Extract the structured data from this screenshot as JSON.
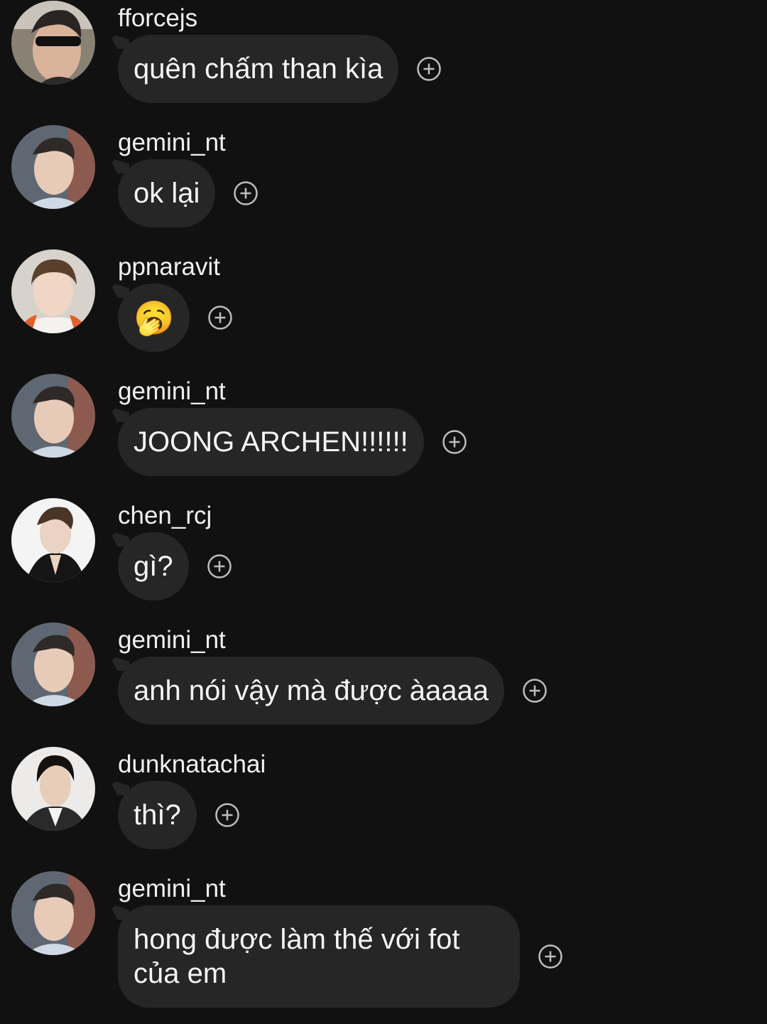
{
  "messages": [
    {
      "username": "fforcejs",
      "text": "quên chấm than kìa",
      "avatar": "avatar-fforcejs",
      "react_icon": "add-reaction-icon"
    },
    {
      "username": "gemini_nt",
      "text": "ok lại",
      "avatar": "avatar-gemini_nt",
      "react_icon": "add-reaction-icon"
    },
    {
      "username": "ppnaravit",
      "text": "🥱",
      "avatar": "avatar-ppnaravit",
      "react_icon": "add-reaction-icon"
    },
    {
      "username": "gemini_nt",
      "text": "JOONG ARCHEN!!!!!!",
      "avatar": "avatar-gemini_nt",
      "react_icon": "add-reaction-icon"
    },
    {
      "username": "chen_rcj",
      "text": "gì?",
      "avatar": "avatar-chen_rcj",
      "react_icon": "add-reaction-icon"
    },
    {
      "username": "gemini_nt",
      "text": "anh nói vậy mà được àaaaa",
      "avatar": "avatar-gemini_nt",
      "react_icon": "add-reaction-icon"
    },
    {
      "username": "dunknatachai",
      "text": "thì?",
      "avatar": "avatar-dunknatachai",
      "react_icon": "add-reaction-icon"
    },
    {
      "username": "gemini_nt",
      "text": "hong được làm thế với fot của em",
      "avatar": "avatar-gemini_nt",
      "react_icon": "add-reaction-icon"
    }
  ],
  "colors": {
    "background": "#111111",
    "bubble": "#262626",
    "text": "#f5f5f5",
    "icon": "#bdbdbd"
  }
}
